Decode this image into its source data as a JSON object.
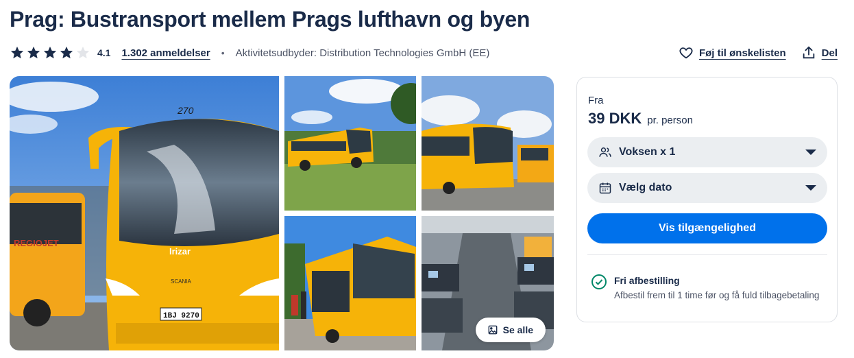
{
  "title": "Prag: Bustransport mellem Prags lufthavn og byen",
  "rating": {
    "stars_filled": 4,
    "stars_total": 5,
    "score": "4.1",
    "reviews_label": "1.302 anmeldelser",
    "separator": "•",
    "provider": "Aktivitetsudbyder: Distribution Technologies GmbH (EE)"
  },
  "actions": {
    "wishlist_label": "Føj til ønskelisten",
    "share_label": "Del"
  },
  "gallery": {
    "main_bus_number": "270",
    "main_bus_brand": "Irizar",
    "main_bus_maker": "SCANIA",
    "main_bus_plate": "1BJ 9270",
    "side_bus_logo": "REGIOJET",
    "see_all_label": "Se alle"
  },
  "booking": {
    "from_label": "Fra",
    "price": "39 DKK",
    "per_label": "pr. person",
    "participants_label": "Voksen x 1",
    "date_label": "Vælg dato",
    "cta_label": "Vis tilgængelighed",
    "cancel_title": "Fri afbestilling",
    "cancel_text": "Afbestil frem til 1 time før og få fuld tilbagebetaling"
  },
  "colors": {
    "primary": "#0071eb",
    "text": "#1a2b49",
    "bus_yellow": "#f5b500",
    "check_green": "#008768"
  }
}
